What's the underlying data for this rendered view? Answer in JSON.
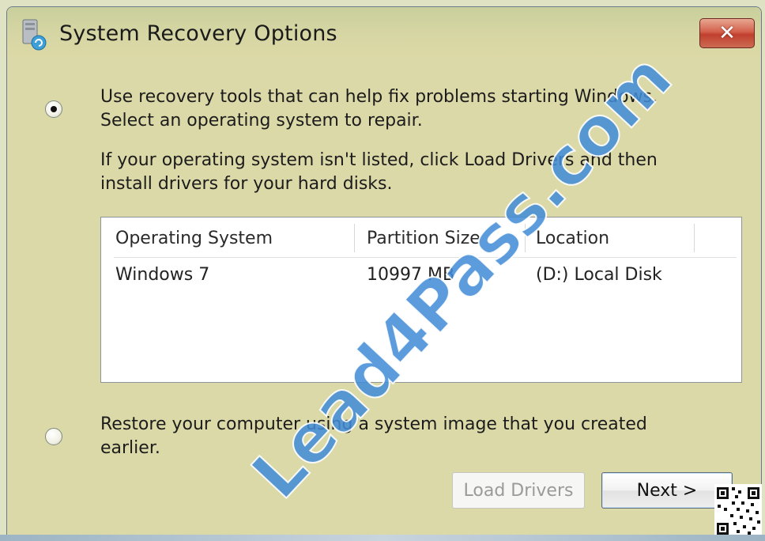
{
  "window": {
    "title": "System Recovery Options",
    "close_glyph": "✕"
  },
  "options": [
    {
      "selected": true,
      "lines": [
        "Use recovery tools that can help fix problems starting Windows.",
        "Select an operating system to repair."
      ]
    },
    {
      "selected": false,
      "lines": [
        "Restore your computer using a system image that you created",
        "earlier."
      ]
    }
  ],
  "note": {
    "lines": [
      "If your operating system isn't listed, click Load Drivers and then",
      "install drivers for your hard disks."
    ]
  },
  "os_list": {
    "columns": [
      "Operating System",
      "Partition Size",
      "Location"
    ],
    "rows": [
      [
        "Windows 7",
        "10997 MB",
        "(D:) Local Disk"
      ]
    ]
  },
  "buttons": {
    "load_drivers": "Load Drivers",
    "next": "Next >"
  },
  "watermark": {
    "text": "Lead4Pass.com"
  },
  "colors": {
    "window_bg": "#dcd9a8",
    "close_button": "#c0402e",
    "watermark": "#418cd7"
  }
}
